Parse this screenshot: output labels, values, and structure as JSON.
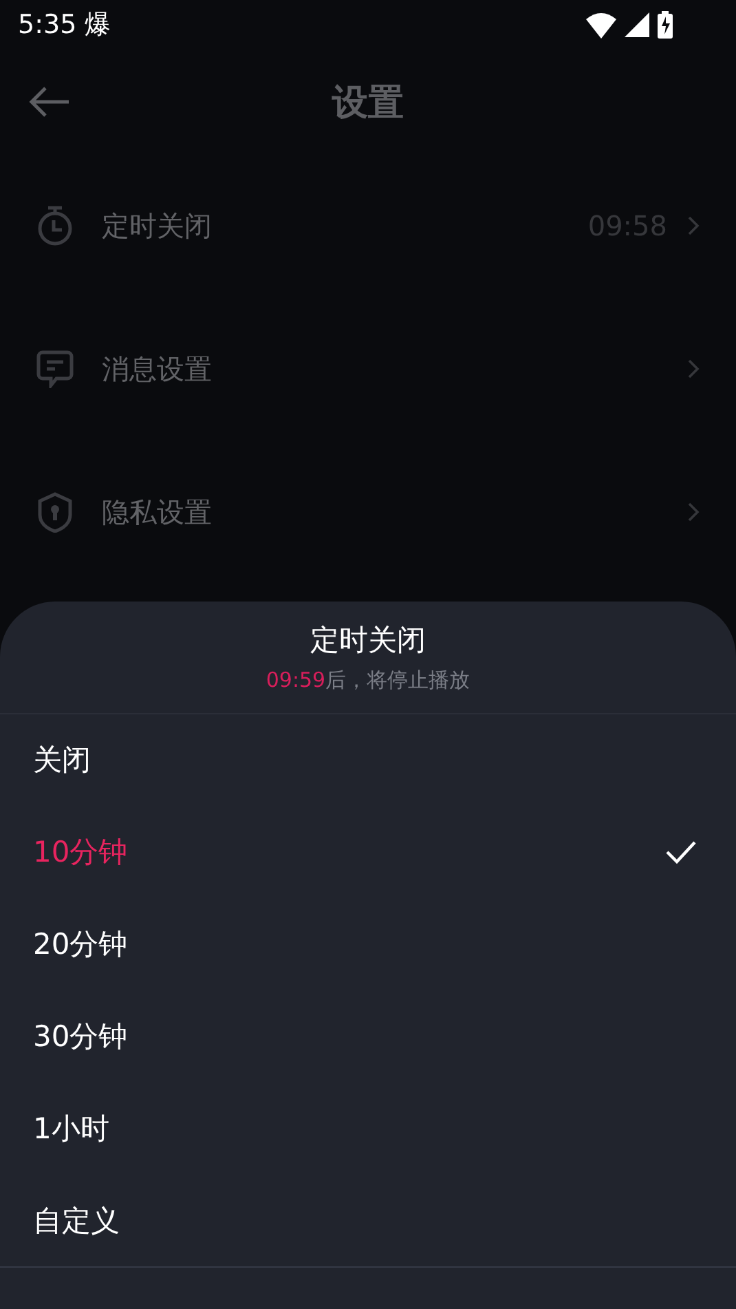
{
  "status_bar": {
    "time": "5:35",
    "notification": "爆"
  },
  "header": {
    "title": "设置"
  },
  "settings": [
    {
      "kind": "timer",
      "label": "定时关闭",
      "value": "09:58"
    },
    {
      "kind": "message",
      "label": "消息设置"
    },
    {
      "kind": "privacy",
      "label": "隐私设置"
    }
  ],
  "sheet": {
    "title": "定时关闭",
    "countdown": "09:59",
    "subtitle": "后，将停止播放",
    "options": [
      {
        "label": "关闭",
        "selected": false
      },
      {
        "label": "10分钟",
        "selected": true
      },
      {
        "label": "20分钟",
        "selected": false
      },
      {
        "label": "30分钟",
        "selected": false
      },
      {
        "label": "1小时",
        "selected": false
      },
      {
        "label": "自定义",
        "selected": false
      }
    ]
  }
}
